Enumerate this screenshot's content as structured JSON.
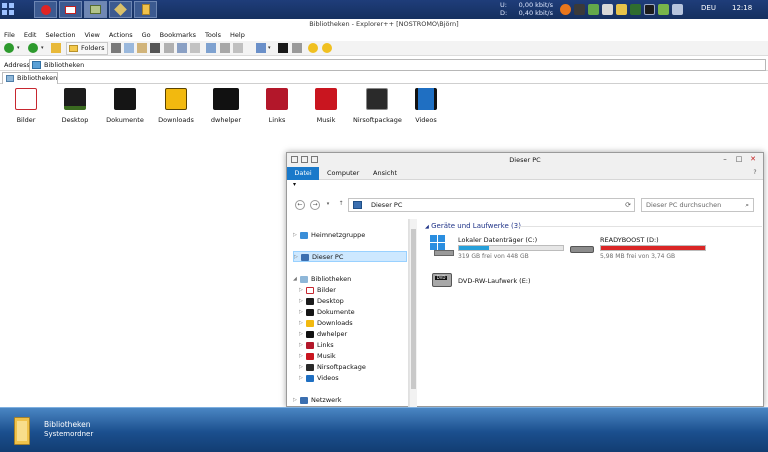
{
  "taskbar": {
    "net": {
      "up_label": "U:",
      "up_value": "0,00 kbit/s",
      "down_label": "D:",
      "down_value": "0,40 kbit/s"
    },
    "language": "DEU",
    "clock": "12:18"
  },
  "explorer": {
    "title": "Bibliotheken - Explorer++ [NOSTROMO\\Björn]",
    "menu": [
      "File",
      "Edit",
      "Selection",
      "View",
      "Actions",
      "Go",
      "Bookmarks",
      "Tools",
      "Help"
    ],
    "folders_button": "Folders",
    "address_label": "Address",
    "address_value": "Bibliotheken",
    "tab_label": "Bibliotheken",
    "libraries": [
      {
        "label": "Bilder",
        "icon": "pictures-icon",
        "color": "#c7272f"
      },
      {
        "label": "Desktop",
        "icon": "desktop-icon",
        "color": "#1c1c1c"
      },
      {
        "label": "Dokumente",
        "icon": "documents-icon",
        "color": "#151515"
      },
      {
        "label": "Downloads",
        "icon": "downloads-icon",
        "color": "#f2b90f"
      },
      {
        "label": "dwhelper",
        "icon": "extras-icon",
        "color": "#111111"
      },
      {
        "label": "Links",
        "icon": "links-icon",
        "color": "#b3172a"
      },
      {
        "label": "Musik",
        "icon": "music-icon",
        "color": "#c9151f"
      },
      {
        "label": "Nirsoftpackage",
        "icon": "package-icon",
        "color": "#2a2a2a"
      },
      {
        "label": "Videos",
        "icon": "videos-icon",
        "color": "#1f6fc2"
      }
    ]
  },
  "pc_window": {
    "title": "Dieser PC",
    "ribbon_tabs": [
      "Datei",
      "Computer",
      "Ansicht"
    ],
    "pin_glyph": "▾",
    "address": "Dieser PC",
    "search_placeholder": "Dieser PC durchsuchen",
    "tree": [
      {
        "label": "Heimnetzgruppe",
        "level": 0,
        "icon": "homegroup-icon"
      },
      {
        "label": "Dieser PC",
        "level": 0,
        "icon": "computer-icon",
        "selected": true
      },
      {
        "label": "Bibliotheken",
        "level": 0,
        "icon": "libraries-icon"
      },
      {
        "label": "Bilder",
        "level": 1,
        "icon": "pictures-icon"
      },
      {
        "label": "Desktop",
        "level": 1,
        "icon": "desktop-icon"
      },
      {
        "label": "Dokumente",
        "level": 1,
        "icon": "documents-icon"
      },
      {
        "label": "Downloads",
        "level": 1,
        "icon": "downloads-icon"
      },
      {
        "label": "dwhelper",
        "level": 1,
        "icon": "extras-icon"
      },
      {
        "label": "Links",
        "level": 1,
        "icon": "links-icon"
      },
      {
        "label": "Musik",
        "level": 1,
        "icon": "music-icon"
      },
      {
        "label": "Nirsoftpackage",
        "level": 1,
        "icon": "package-icon"
      },
      {
        "label": "Videos",
        "level": 1,
        "icon": "videos-icon"
      },
      {
        "label": "Netzwerk",
        "level": 0,
        "icon": "network-icon"
      }
    ],
    "group_title": "Geräte und Laufwerke (3)",
    "drives": [
      {
        "name": "Lokaler Datenträger (C:)",
        "free": "319 GB frei von 448 GB",
        "used_fraction": 0.29,
        "bar_color": "#26a0da",
        "icon": "windows-drive-icon"
      },
      {
        "name": "READYBOOST (D:)",
        "free": "5,98 MB frei von 3,74 GB",
        "used_fraction": 0.998,
        "bar_color": "#da2626",
        "icon": "usb-drive-icon"
      },
      {
        "name": "DVD-RW-Laufwerk (E:)",
        "free": "",
        "used_fraction": null,
        "bar_color": "",
        "icon": "dvd-drive-icon"
      }
    ]
  },
  "bottom": {
    "title": "Bibliotheken",
    "subtitle": "Systemordner"
  }
}
